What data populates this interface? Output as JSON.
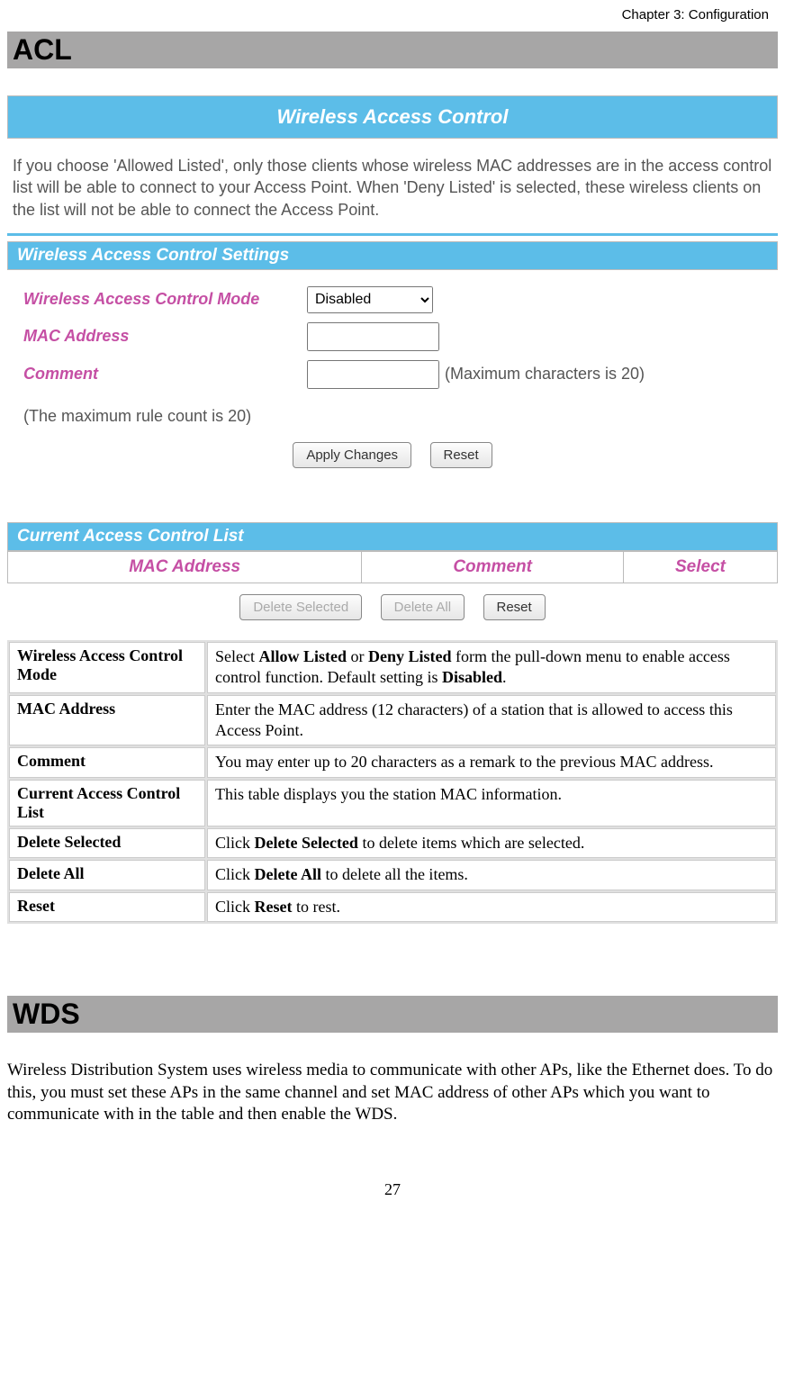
{
  "header": {
    "chapter": "Chapter 3: Configuration"
  },
  "acl": {
    "title": "ACL",
    "panel_title": "Wireless Access Control",
    "intro": "If you choose 'Allowed Listed', only those clients whose wireless MAC addresses are in the access control list will be able to connect to your Access Point. When 'Deny Listed' is selected, these wireless clients on the list will not be able to connect the Access Point.",
    "settings_title": "Wireless Access Control Settings",
    "fields": {
      "mode_label": "Wireless Access Control Mode",
      "mode_value": "Disabled",
      "mac_label": "MAC Address",
      "mac_value": "",
      "comment_label": "Comment",
      "comment_value": "",
      "comment_hint": "(Maximum characters is 20)",
      "max_rule_note": "(The maximum rule count is 20)"
    },
    "buttons": {
      "apply": "Apply Changes",
      "reset": "Reset",
      "delete_selected": "Delete Selected",
      "delete_all": "Delete All"
    },
    "list_title": "Current Access Control List",
    "list_cols": {
      "mac": "MAC Address",
      "comment": "Comment",
      "select": "Select"
    }
  },
  "desc": {
    "rows": [
      {
        "term": "Wireless Access Control Mode",
        "def_parts": [
          "Select ",
          "Allow Listed",
          " or ",
          "Deny Listed",
          " form the pull-down menu to enable access control function. Default setting is ",
          "Disabled",
          "."
        ],
        "bold_idx": [
          1,
          3,
          5
        ]
      },
      {
        "term": "MAC Address",
        "def": "Enter the MAC address (12 characters)  of a station that is allowed to access this Access Point."
      },
      {
        "term": "Comment",
        "def": "You may enter up to 20 characters as a remark to the previous MAC address.",
        "justify": true
      },
      {
        "term": "Current Access Control List",
        "def": " This table displays you the station MAC information."
      },
      {
        "term": "Delete Selected",
        "def_parts": [
          "Click  ",
          "Delete Selected",
          " to delete items which are selected."
        ],
        "bold_idx": [
          1
        ]
      },
      {
        "term": "Delete All",
        "def_parts": [
          "Click  ",
          "Delete All",
          " to delete all the items."
        ],
        "bold_idx": [
          1
        ]
      },
      {
        "term": "Reset",
        "def_parts": [
          "Click  ",
          "Reset",
          " to rest."
        ],
        "bold_idx": [
          1
        ]
      }
    ]
  },
  "wds": {
    "title": "WDS",
    "paragraph": "Wireless Distribution System uses wireless media to communicate with other APs, like the Ethernet does. To do this, you must set these APs in the same channel and set MAC address of other APs which you want to communicate with in the table and then enable the WDS."
  },
  "page_number": "27"
}
